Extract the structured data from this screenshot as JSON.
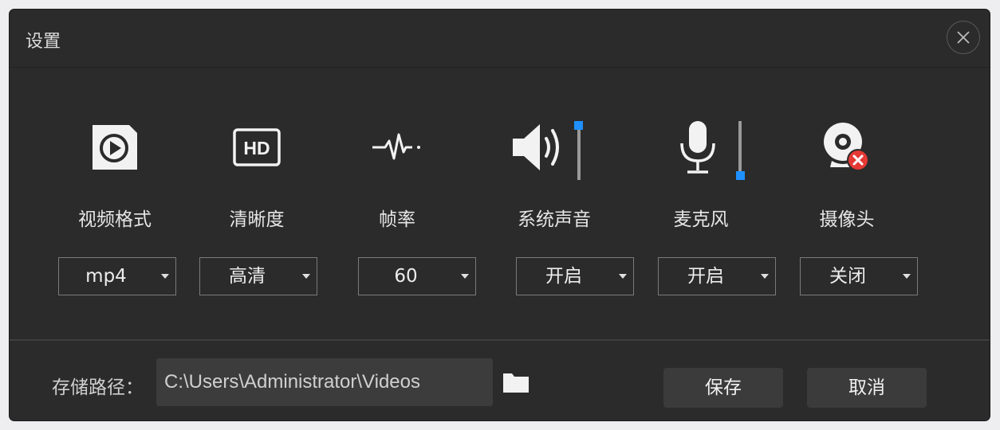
{
  "dialog": {
    "title": "设置",
    "close_icon": "close-icon"
  },
  "items": [
    {
      "key": "video_format",
      "label": "视频格式",
      "icon": "video-play-icon",
      "selected": "mp4"
    },
    {
      "key": "clarity",
      "label": "清晰度",
      "icon": "hd-icon",
      "selected": "高清"
    },
    {
      "key": "frame_rate",
      "label": "帧率",
      "icon": "waveform-icon",
      "selected": "60"
    },
    {
      "key": "system_sound",
      "label": "系统声音",
      "icon": "speaker-icon",
      "selected": "开启",
      "level": 1.0
    },
    {
      "key": "microphone",
      "label": "麦克风",
      "icon": "microphone-icon",
      "selected": "开启",
      "level": 0.0
    },
    {
      "key": "camera",
      "label": "摄像头",
      "icon": "webcam-disabled-icon",
      "selected": "关闭"
    }
  ],
  "storage": {
    "label": "存储路径：",
    "path": "C:\\Users\\Administrator\\Videos",
    "folder_icon": "folder-icon"
  },
  "buttons": {
    "save": "保存",
    "cancel": "取消"
  },
  "colors": {
    "background": "#2b2b2b",
    "accent": "#1e90ff",
    "error": "#e53935"
  }
}
